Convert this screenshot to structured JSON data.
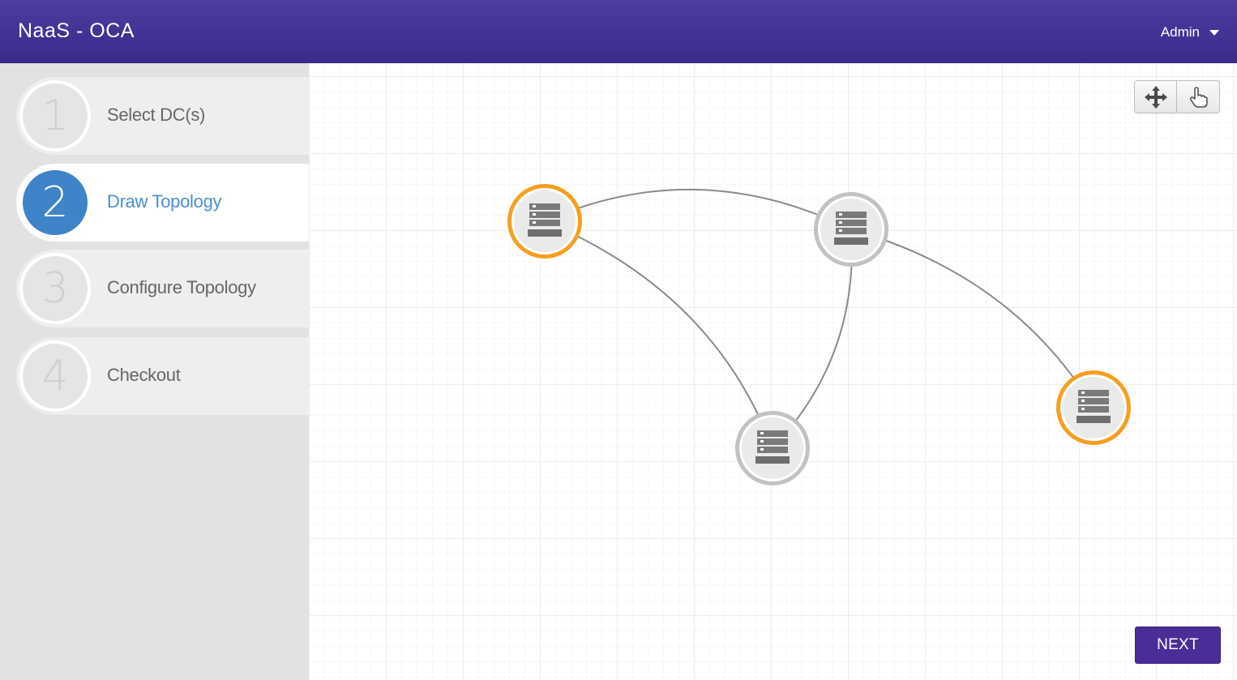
{
  "header": {
    "app_title": "NaaS - OCA",
    "user_label": "Admin"
  },
  "steps": [
    {
      "number": "1",
      "label": "Select DC(s)",
      "active": false
    },
    {
      "number": "2",
      "label": "Draw Topology",
      "active": true
    },
    {
      "number": "3",
      "label": "Configure Topology",
      "active": false
    },
    {
      "number": "4",
      "label": "Checkout",
      "active": false
    }
  ],
  "toolbar": {
    "pan_icon": "move-arrows-icon",
    "select_icon": "pointer-hand-icon"
  },
  "topology": {
    "nodes": [
      {
        "id": "dc-a",
        "icon": "server-icon",
        "state": "selected"
      },
      {
        "id": "dc-b",
        "icon": "server-icon",
        "state": "default"
      },
      {
        "id": "dc-c",
        "icon": "server-icon",
        "state": "default"
      },
      {
        "id": "dc-d",
        "icon": "server-icon",
        "state": "selected"
      }
    ],
    "links": [
      [
        "dc-a",
        "dc-b"
      ],
      [
        "dc-a",
        "dc-c"
      ],
      [
        "dc-b",
        "dc-c"
      ],
      [
        "dc-b",
        "dc-d"
      ]
    ],
    "colors": {
      "selected_ring": "#f5a021",
      "default_ring": "#c2c2c2",
      "link": "#8a8a8a"
    }
  },
  "footer": {
    "next_label": "NEXT"
  },
  "colors": {
    "header_bg": "#43349a",
    "accent_blue": "#3f84c9",
    "next_bg": "#4a2d96"
  }
}
